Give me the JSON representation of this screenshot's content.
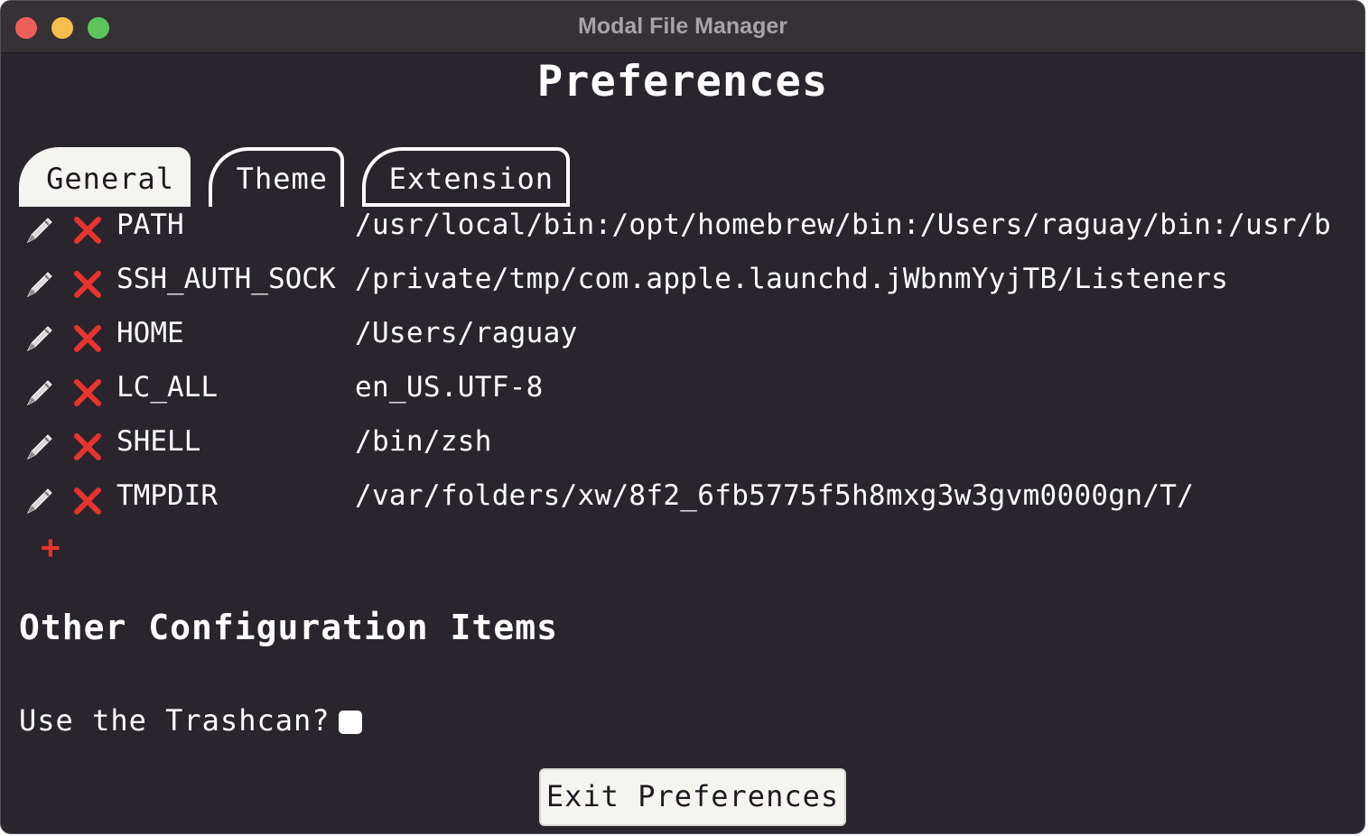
{
  "window": {
    "title": "Modal File Manager"
  },
  "page": {
    "title": "Preferences"
  },
  "tabs": [
    {
      "label": "General",
      "active": true
    },
    {
      "label": "Theme",
      "active": false
    },
    {
      "label": "Extension",
      "active": false
    }
  ],
  "env": [
    {
      "key": "PATH",
      "value": "/usr/local/bin:/opt/homebrew/bin:/Users/raguay/bin:/usr/b"
    },
    {
      "key": "SSH_AUTH_SOCK",
      "value": "/private/tmp/com.apple.launchd.jWbnmYyjTB/Listeners"
    },
    {
      "key": "HOME",
      "value": "/Users/raguay"
    },
    {
      "key": "LC_ALL",
      "value": "en_US.UTF-8"
    },
    {
      "key": "SHELL",
      "value": "/bin/zsh"
    },
    {
      "key": "TMPDIR",
      "value": "/var/folders/xw/8f2_6fb5775f5h8mxg3w3gvm0000gn/T/"
    }
  ],
  "icons": {
    "edit": "pencil-icon",
    "delete": "red-x-icon",
    "add": "plus-icon"
  },
  "add_label": "+",
  "other_config": {
    "title": "Other Configuration Items",
    "trash_label": "Use the Trashcan?",
    "trash_checked": false
  },
  "exit_button": {
    "label": "Exit Preferences"
  },
  "colors": {
    "background": "#2a252d",
    "titlebar": "#353135",
    "delete": "#e8342e",
    "text": "#ffffff"
  }
}
